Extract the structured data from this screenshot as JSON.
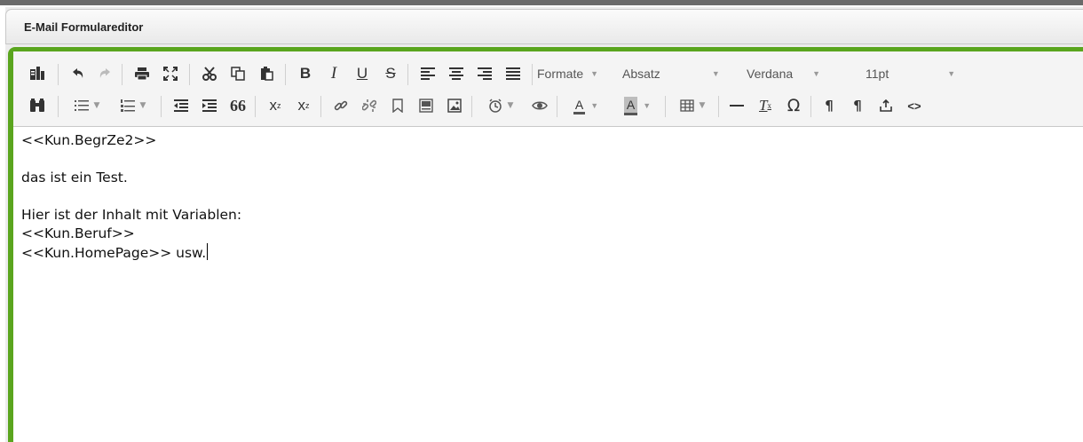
{
  "window": {
    "title": "E-Mail Formulareditor"
  },
  "toolbar": {
    "row1": {
      "icons": [
        "templates-icon",
        "undo-icon",
        "redo-icon",
        "print-icon",
        "fullscreen-icon",
        "cut-icon",
        "copy-icon",
        "paste-icon",
        "bold-icon",
        "italic-icon",
        "underline-icon",
        "strikethrough-icon",
        "align-left-icon",
        "align-center-icon",
        "align-right-icon",
        "align-justify-icon"
      ],
      "bold_label": "B",
      "italic_label": "I",
      "underline_label": "U",
      "strike_label": "S",
      "formats_label": "Formate",
      "block_label": "Absatz",
      "font_label": "Verdana",
      "size_label": "11pt"
    },
    "row2": {
      "icons": [
        "find-replace-icon",
        "bullet-list-icon",
        "numbered-list-icon",
        "outdent-icon",
        "indent-icon",
        "blockquote-icon",
        "subscript-icon",
        "superscript-icon",
        "link-icon",
        "unlink-icon",
        "anchor-icon",
        "document-icon",
        "image-icon",
        "insert-datetime-icon",
        "preview-icon",
        "text-color-icon",
        "background-color-icon",
        "table-icon",
        "horizontal-rule-icon",
        "clear-format-icon",
        "special-char-icon",
        "pilcrow-icon",
        "pilcrow-rtl-icon",
        "insert-variable-icon",
        "source-code-icon"
      ],
      "blockquote_label": "66",
      "subscript_label": "x",
      "superscript_label": "x",
      "text_color_label": "A",
      "bg_color_label": "A",
      "clear_format_label": "T",
      "omega_label": "Ω",
      "pilcrow_label": "¶",
      "source_label": "<>"
    }
  },
  "content": {
    "line1": "<<Kun.BegrZe2>>",
    "line2": "das ist ein Test.",
    "line3": "Hier ist der Inhalt mit Variablen:",
    "line4": "<<Kun.Beruf>>",
    "line5": "<<Kun.HomePage>> usw."
  },
  "colors": {
    "accent_green": "#5aa51e",
    "toolbar_bg": "#f4f4f4"
  }
}
